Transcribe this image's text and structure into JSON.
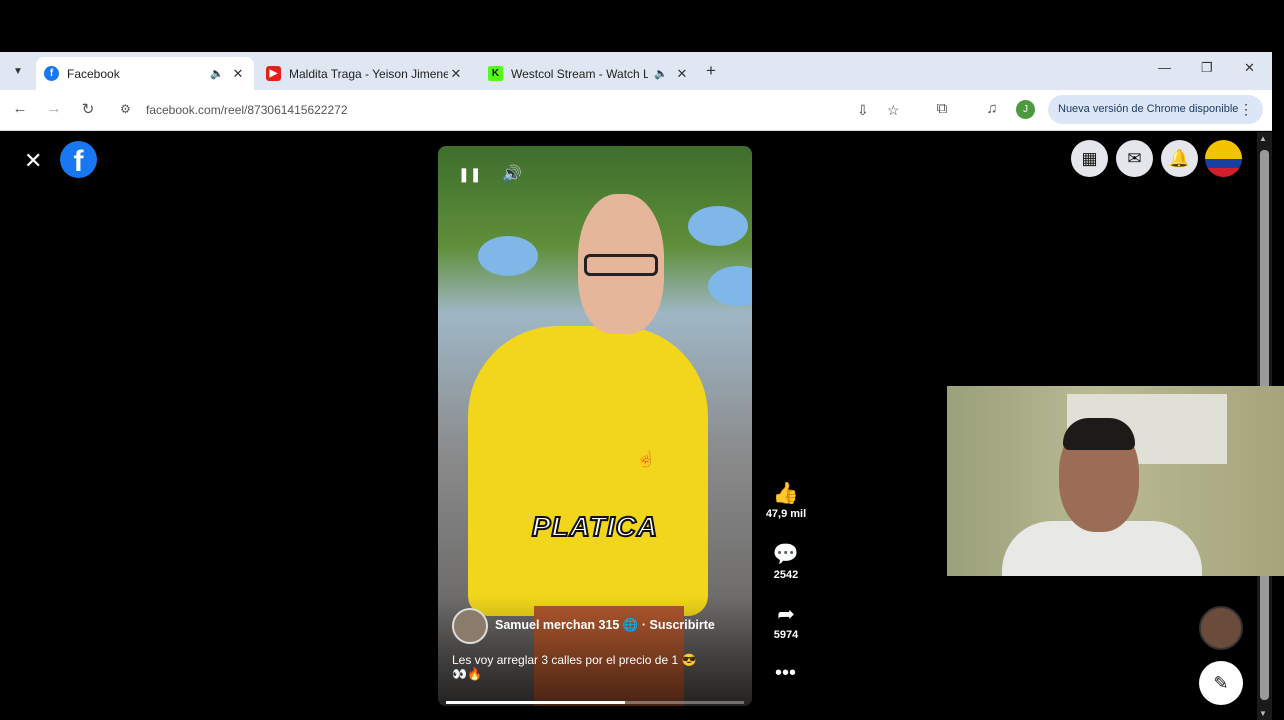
{
  "browser": {
    "tabs": [
      {
        "title": "Facebook",
        "favicon": "facebook-favicon",
        "active": true,
        "audio": true
      },
      {
        "title": "Maldita Traga - Yeison Jimenez",
        "favicon": "youtube-favicon",
        "active": false,
        "audio": false
      },
      {
        "title": "Westcol Stream - Watch Live",
        "favicon": "kick-favicon",
        "active": false,
        "audio": true
      }
    ],
    "url": "facebook.com/reel/873061415622272",
    "profile_initial": "J",
    "update_label": "Nueva versión de Chrome disponible",
    "colors": {
      "tabbar": "#dfe7f3",
      "pill": "#dbe6f7",
      "facebook_blue": "#1877f2"
    }
  },
  "reel": {
    "overlay_text": "PLATICA",
    "author": "Samuel merchan 315",
    "follow_label": "Suscribirte",
    "caption": "Les voy arreglar 3 calles por el precio de 1 😎",
    "caption_emojis": "👀🔥",
    "progress": 0.6,
    "likes": "47,9 mil",
    "comments": "2542",
    "shares": "5974"
  },
  "icons": {
    "close": "✕",
    "pause": "❚❚",
    "volume": "🔊",
    "like": "👍",
    "comment": "💬",
    "share": "➦",
    "more": "•••",
    "menu_grid": "▦",
    "messenger": "✉",
    "bell": "🔔",
    "compose": "✎"
  }
}
